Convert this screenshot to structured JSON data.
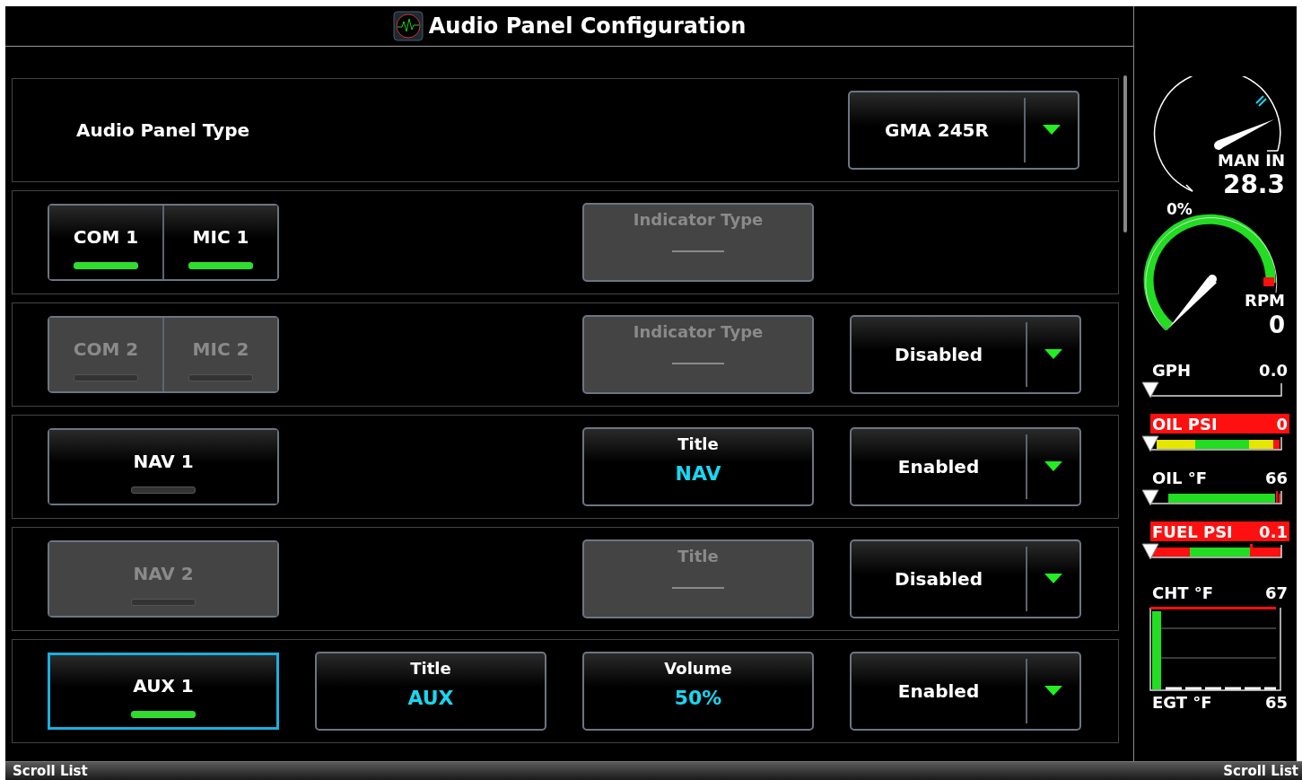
{
  "header": {
    "title": "Audio Panel Configuration"
  },
  "panel_type": {
    "label": "Audio Panel Type",
    "dropdown": "GMA 245R"
  },
  "rows": [
    {
      "disabled": false,
      "toggles": [
        {
          "label": "COM 1",
          "on": true,
          "selected": false
        },
        {
          "label": "MIC 1",
          "on": true,
          "selected": false
        }
      ],
      "right_field": {
        "label": "Indicator Type",
        "disabled": true
      }
    },
    {
      "disabled": true,
      "toggles": [
        {
          "label": "COM 2",
          "on": false,
          "selected": false
        },
        {
          "label": "MIC 2",
          "on": false,
          "selected": false
        }
      ],
      "right_field": {
        "label": "Indicator Type",
        "disabled": true
      },
      "dropdown": "Disabled"
    },
    {
      "disabled": false,
      "toggles": [
        {
          "label": "NAV 1",
          "on": false,
          "selected": false
        }
      ],
      "right_field": {
        "label": "Title",
        "value": "NAV",
        "disabled": false
      },
      "dropdown": "Enabled"
    },
    {
      "disabled": true,
      "toggles": [
        {
          "label": "NAV 2",
          "on": false,
          "selected": false
        }
      ],
      "right_field": {
        "label": "Title",
        "disabled": true
      },
      "dropdown": "Disabled"
    },
    {
      "disabled": false,
      "toggles": [
        {
          "label": "AUX 1",
          "on": true,
          "selected": true
        }
      ],
      "left_field": {
        "label": "Title",
        "value": "AUX",
        "disabled": false
      },
      "right_field": {
        "label": "Volume",
        "value": "50%",
        "disabled": false
      },
      "dropdown": "Enabled"
    }
  ],
  "engine": {
    "manifold": {
      "label": "MAN IN",
      "value": "28.3"
    },
    "rpm": {
      "caption": "0%",
      "label": "RPM",
      "value": "0"
    },
    "bars": [
      {
        "kind": "flow",
        "label": "GPH",
        "value": "0.0",
        "alert": false
      },
      {
        "kind": "pressure",
        "label": "OIL PSI",
        "value": "0",
        "alert": true
      },
      {
        "kind": "temperature",
        "label": "OIL °F",
        "value": "66",
        "alert": false
      },
      {
        "kind": "fuel",
        "label": "FUEL PSI",
        "value": "0.1",
        "alert": true
      }
    ],
    "cylinders": {
      "top_label": "CHT °F",
      "top_value": "67",
      "bottom_label": "EGT °F",
      "bottom_value": "65"
    }
  },
  "footer": {
    "left": "Scroll List",
    "right": "Scroll List"
  }
}
